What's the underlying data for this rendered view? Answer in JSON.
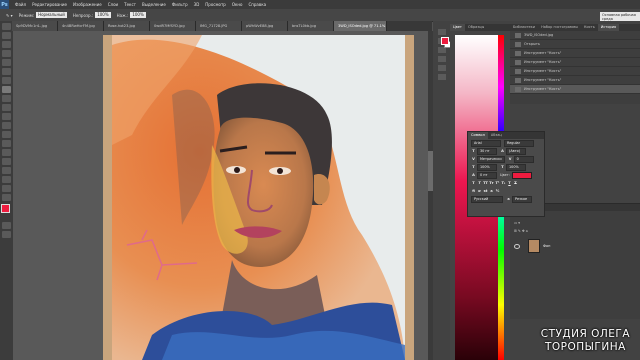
{
  "app_logo": "Ps",
  "menu": [
    "Файл",
    "Редактирование",
    "Изображение",
    "Слои",
    "Текст",
    "Выделение",
    "Фильтр",
    "3D",
    "Просмотр",
    "Окно",
    "Справка"
  ],
  "options": {
    "mode_label": "Режим:",
    "mode_value": "Нормальный",
    "opacity_label": "Непрозр.:",
    "opacity_value": "100%",
    "pressure_label": "Наж.:",
    "pressure_value": "100%"
  },
  "workspace_button": "Основная рабочая среда",
  "tabs": [
    {
      "label": "Sp9DVMc1r4-.jpg",
      "active": false
    },
    {
      "label": "4n4BRwHcrFM.jpg",
      "active": false
    },
    {
      "label": "Rose-hot23.jpg",
      "active": false
    },
    {
      "label": "0wdR7MfSYD.jpg",
      "active": false
    },
    {
      "label": "IMG_71728.JPG",
      "active": false
    },
    {
      "label": "pWhWvE88.jpg",
      "active": false
    },
    {
      "label": "bnsTL0kb.jpg",
      "active": false
    },
    {
      "label": "3WD_ISOded.jpg @ 71.1% (RGB/8)",
      "active": true
    }
  ],
  "color_panel_tabs": [
    "Цвет",
    "Образцы"
  ],
  "history_tabs": [
    "Библиотеки",
    "Набор гистограммы",
    "Кисть",
    "История"
  ],
  "history": {
    "file": "3WD_ISOded.jpg",
    "items": [
      "Открыть",
      "Инструмент \"Кисть\"",
      "Инструмент \"Кисть\"",
      "Инструмент \"Кисть\"",
      "Инструмент \"Кисть\"",
      "Инструмент \"Кисть\""
    ],
    "selected_index": 5
  },
  "character_panel": {
    "tabs": [
      "Символ",
      "Абзац"
    ],
    "font": "Arial",
    "style": "Regular",
    "size": "30 пт",
    "leading": "(Авто)",
    "kerning": "Метрически",
    "tracking": "0",
    "vscale": "100%",
    "hscale": "100%",
    "baseline": "0 пт",
    "color_label": "Цвет:",
    "color_hex": "#ee1c3f",
    "language": "Русский",
    "antialias": "Резкое"
  },
  "layers_panel": {
    "tab": "Слои",
    "layer_name": "Фон"
  },
  "watermark": [
    "СТУДИЯ ОЛЕГА",
    "ТОРОПЫГИНА"
  ],
  "foreground_color": "#ee1c3f",
  "background_color": "#ffffff"
}
